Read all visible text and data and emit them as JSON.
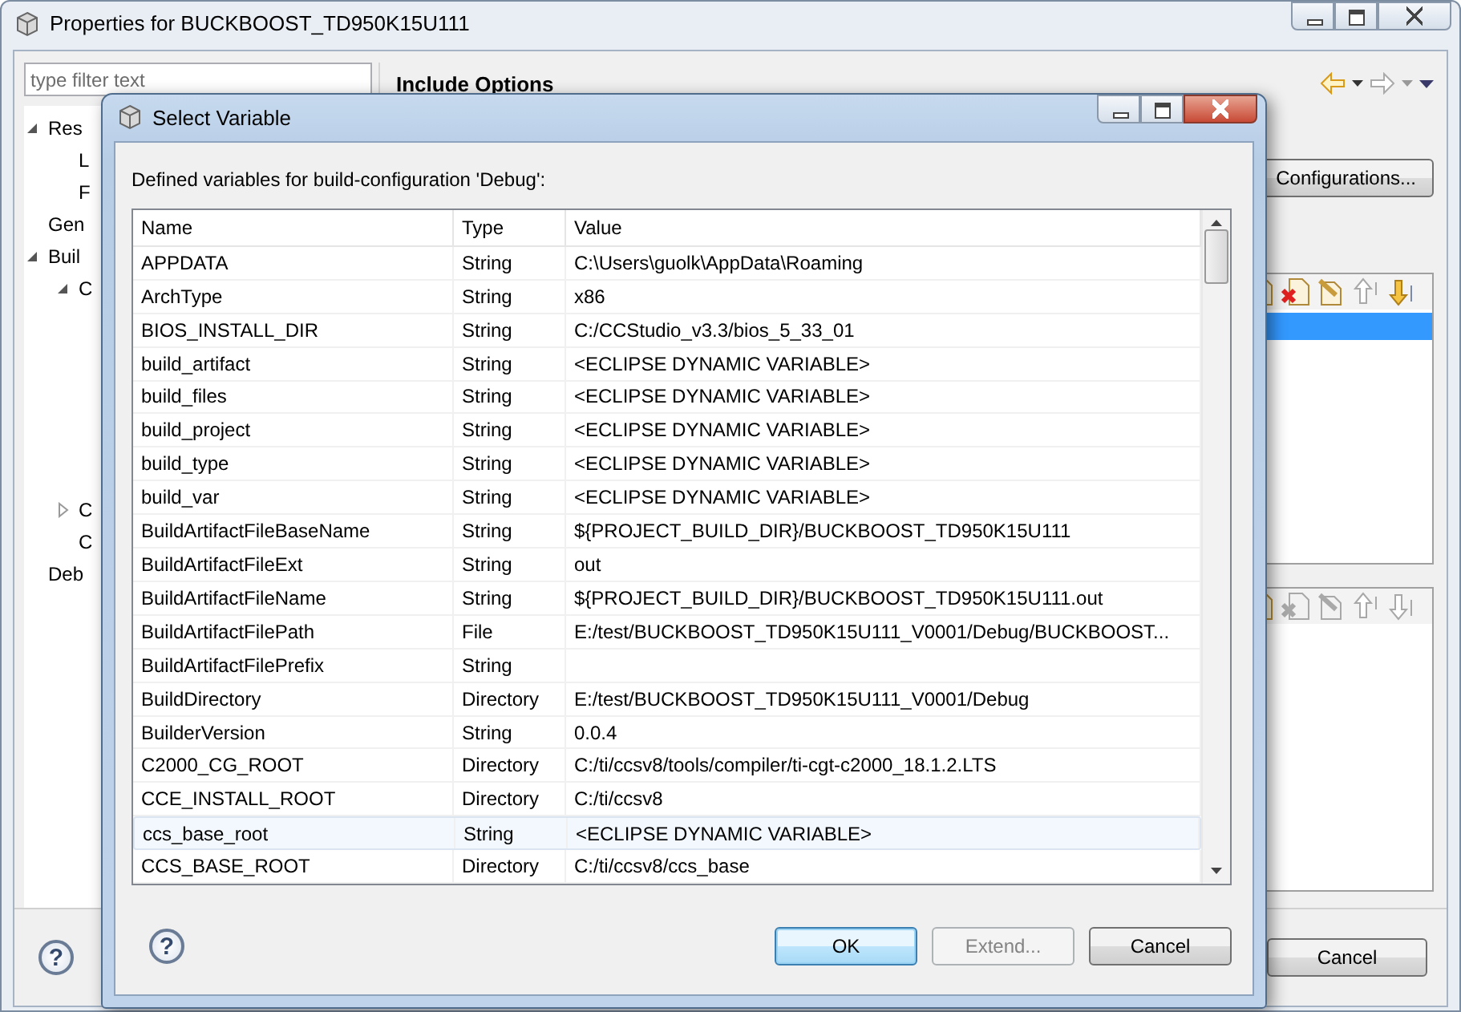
{
  "window": {
    "title": "Properties for BUCKBOOST_TD950K15U111"
  },
  "filter": {
    "placeholder": "type filter text"
  },
  "tree": [
    {
      "label": "Res",
      "expanded": true,
      "children": [
        {
          "label": "L"
        },
        {
          "label": "F"
        }
      ]
    },
    {
      "label": "Gen"
    },
    {
      "label": "Buil",
      "expanded": true,
      "children": [
        {
          "label": "C",
          "expanded": true
        },
        {
          "label": "C",
          "expanded": false
        },
        {
          "label": "C"
        }
      ]
    },
    {
      "label": "Deb"
    }
  ],
  "page_title": "Include Options",
  "configurations_button": "Configurations...",
  "panels": [
    {
      "selected_row": true,
      "tools": [
        {
          "kind": "document",
          "disabled": false
        },
        {
          "kind": "delete",
          "disabled": false
        },
        {
          "kind": "edit",
          "disabled": false
        },
        {
          "kind": "up",
          "disabled": true
        },
        {
          "kind": "down",
          "disabled": false
        }
      ]
    },
    {
      "selected_row": false,
      "tools": [
        {
          "kind": "document",
          "disabled": false
        },
        {
          "kind": "delete",
          "disabled": true
        },
        {
          "kind": "edit",
          "disabled": true
        },
        {
          "kind": "up",
          "disabled": true
        },
        {
          "kind": "down",
          "disabled": true
        }
      ]
    }
  ],
  "help": "?",
  "buttons": [
    {
      "label": "Cancel"
    }
  ],
  "dialog": {
    "title": "Select Variable",
    "prompt": "Defined variables for build-configuration 'Debug':",
    "columns": [
      "Name",
      "Type",
      "Value"
    ],
    "rows": [
      {
        "name": "APPDATA",
        "type": "String",
        "value": "C:\\Users\\guolk\\AppData\\Roaming",
        "selected": false
      },
      {
        "name": "ArchType",
        "type": "String",
        "value": "x86",
        "selected": false
      },
      {
        "name": "BIOS_INSTALL_DIR",
        "type": "String",
        "value": "C:/CCStudio_v3.3/bios_5_33_01",
        "selected": false
      },
      {
        "name": "build_artifact",
        "type": "String",
        "value": "<ECLIPSE DYNAMIC VARIABLE>",
        "selected": false
      },
      {
        "name": "build_files",
        "type": "String",
        "value": "<ECLIPSE DYNAMIC VARIABLE>",
        "selected": false
      },
      {
        "name": "build_project",
        "type": "String",
        "value": "<ECLIPSE DYNAMIC VARIABLE>",
        "selected": false
      },
      {
        "name": "build_type",
        "type": "String",
        "value": "<ECLIPSE DYNAMIC VARIABLE>",
        "selected": false
      },
      {
        "name": "build_var",
        "type": "String",
        "value": "<ECLIPSE DYNAMIC VARIABLE>",
        "selected": false
      },
      {
        "name": "BuildArtifactFileBaseName",
        "type": "String",
        "value": "${PROJECT_BUILD_DIR}/BUCKBOOST_TD950K15U111",
        "selected": false
      },
      {
        "name": "BuildArtifactFileExt",
        "type": "String",
        "value": "out",
        "selected": false
      },
      {
        "name": "BuildArtifactFileName",
        "type": "String",
        "value": "${PROJECT_BUILD_DIR}/BUCKBOOST_TD950K15U111.out",
        "selected": false
      },
      {
        "name": "BuildArtifactFilePath",
        "type": "File",
        "value": "E:/test/BUCKBOOST_TD950K15U111_V0001/Debug/BUCKBOOST...",
        "selected": false
      },
      {
        "name": "BuildArtifactFilePrefix",
        "type": "String",
        "selected": false
      },
      {
        "name": "BuildDirectory",
        "type": "Directory",
        "value": "E:/test/BUCKBOOST_TD950K15U111_V0001/Debug",
        "selected": false
      },
      {
        "name": "BuilderVersion",
        "type": "String",
        "value": "0.0.4",
        "selected": false
      },
      {
        "name": "C2000_CG_ROOT",
        "type": "Directory",
        "value": "C:/ti/ccsv8/tools/compiler/ti-cgt-c2000_18.1.2.LTS",
        "selected": false
      },
      {
        "name": "CCE_INSTALL_ROOT",
        "type": "Directory",
        "value": "C:/ti/ccsv8",
        "selected": false
      },
      {
        "name": "ccs_base_root",
        "type": "String",
        "value": "<ECLIPSE DYNAMIC VARIABLE>",
        "selected": true
      },
      {
        "name": "CCS_BASE_ROOT",
        "type": "Directory",
        "value": "C:/ti/ccsv8/ccs_base",
        "selected": false
      }
    ],
    "buttons": [
      {
        "label": "OK",
        "kind": "default",
        "disabled": false
      },
      {
        "label": "Extend...",
        "kind": "normal",
        "disabled": true
      },
      {
        "label": "Cancel",
        "kind": "normal",
        "disabled": false
      }
    ]
  }
}
